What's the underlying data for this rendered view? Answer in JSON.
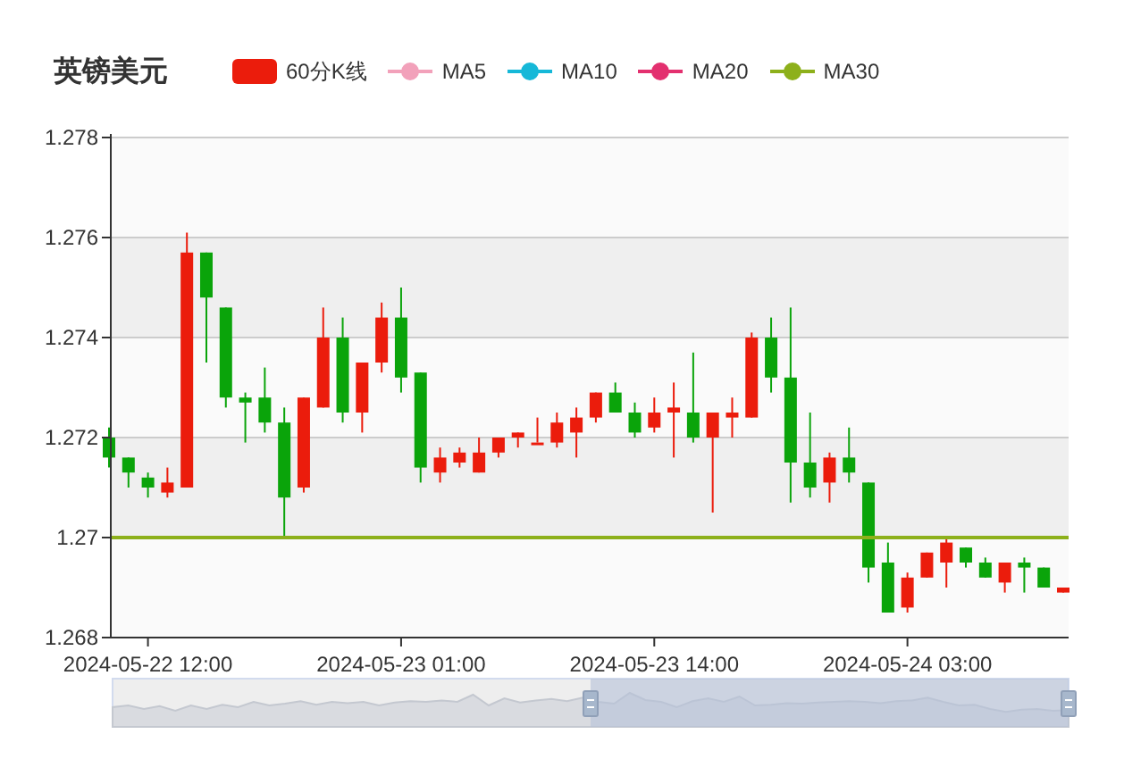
{
  "title": "英镑美元",
  "legend": {
    "label": "60分K线",
    "color": "#eb1c0c"
  },
  "chart_data": {
    "type": "candlestick",
    "ylim": [
      1.268,
      1.278
    ],
    "yticks": [
      {
        "value": 1.278,
        "label": "1.278"
      },
      {
        "value": 1.276,
        "label": "1.276"
      },
      {
        "value": 1.274,
        "label": "1.274"
      },
      {
        "value": 1.272,
        "label": "1.272"
      },
      {
        "value": 1.27,
        "label": "1.27"
      },
      {
        "value": 1.268,
        "label": "1.268"
      }
    ],
    "categories": [
      null,
      null,
      "2024-05-22 12:00",
      null,
      null,
      null,
      null,
      null,
      null,
      null,
      null,
      null,
      null,
      null,
      null,
      "2024-05-23 01:00",
      null,
      null,
      null,
      null,
      null,
      null,
      null,
      null,
      null,
      null,
      null,
      null,
      "2024-05-23 14:00",
      null,
      null,
      null,
      null,
      null,
      null,
      null,
      null,
      null,
      null,
      null,
      null,
      "2024-05-24 03:00",
      null,
      null,
      null,
      null,
      null,
      null,
      null,
      null
    ],
    "ohlc": [
      [
        1.272,
        1.2722,
        1.2714,
        1.2716
      ],
      [
        1.2716,
        1.2716,
        1.271,
        1.2713
      ],
      [
        1.2712,
        1.2713,
        1.2708,
        1.271
      ],
      [
        1.2709,
        1.2714,
        1.2708,
        1.2711
      ],
      [
        1.271,
        1.2761,
        1.271,
        1.2757
      ],
      [
        1.2757,
        1.2757,
        1.2735,
        1.2748
      ],
      [
        1.2746,
        1.2746,
        1.2726,
        1.2728
      ],
      [
        1.2728,
        1.2729,
        1.2719,
        1.2727
      ],
      [
        1.2728,
        1.2734,
        1.2721,
        1.2723
      ],
      [
        1.2723,
        1.2726,
        1.27,
        1.2708
      ],
      [
        1.271,
        1.2728,
        1.2709,
        1.2728
      ],
      [
        1.2726,
        1.2746,
        1.2726,
        1.274
      ],
      [
        1.274,
        1.2744,
        1.2723,
        1.2725
      ],
      [
        1.2725,
        1.2735,
        1.2721,
        1.2735
      ],
      [
        1.2735,
        1.2747,
        1.2733,
        1.2744
      ],
      [
        1.2744,
        1.275,
        1.2729,
        1.2732
      ],
      [
        1.2733,
        1.2733,
        1.2711,
        1.2714
      ],
      [
        1.2713,
        1.2718,
        1.2711,
        1.2716
      ],
      [
        1.2715,
        1.2718,
        1.2714,
        1.2717
      ],
      [
        1.2713,
        1.272,
        1.2713,
        1.2717
      ],
      [
        1.2717,
        1.272,
        1.2716,
        1.272
      ],
      [
        1.272,
        1.2721,
        1.2718,
        1.2721
      ],
      [
        1.2719,
        1.2724,
        1.2719,
        1.2719
      ],
      [
        1.2719,
        1.2725,
        1.2718,
        1.2723
      ],
      [
        1.2721,
        1.2726,
        1.2716,
        1.2724
      ],
      [
        1.2724,
        1.2729,
        1.2723,
        1.2729
      ],
      [
        1.2729,
        1.2731,
        1.2725,
        1.2725
      ],
      [
        1.2725,
        1.2727,
        1.272,
        1.2721
      ],
      [
        1.2722,
        1.2728,
        1.2721,
        1.2725
      ],
      [
        1.2725,
        1.2731,
        1.2716,
        1.2726
      ],
      [
        1.2725,
        1.2737,
        1.2719,
        1.272
      ],
      [
        1.272,
        1.2725,
        1.2705,
        1.2725
      ],
      [
        1.2724,
        1.2728,
        1.272,
        1.2725
      ],
      [
        1.2724,
        1.2741,
        1.2724,
        1.274
      ],
      [
        1.274,
        1.2744,
        1.2729,
        1.2732
      ],
      [
        1.2732,
        1.2746,
        1.2707,
        1.2715
      ],
      [
        1.2715,
        1.2725,
        1.2708,
        1.271
      ],
      [
        1.2711,
        1.2717,
        1.2707,
        1.2716
      ],
      [
        1.2716,
        1.2722,
        1.2711,
        1.2713
      ],
      [
        1.2711,
        1.2711,
        1.2691,
        1.2694
      ],
      [
        1.2695,
        1.2699,
        1.2685,
        1.2685
      ],
      [
        1.2686,
        1.2693,
        1.2685,
        1.2692
      ],
      [
        1.2692,
        1.2697,
        1.2692,
        1.2697
      ],
      [
        1.2695,
        1.27,
        1.269,
        1.2699
      ],
      [
        1.2698,
        1.2698,
        1.2694,
        1.2695
      ],
      [
        1.2695,
        1.2696,
        1.2692,
        1.2692
      ],
      [
        1.2691,
        1.2695,
        1.2689,
        1.2695
      ],
      [
        1.2695,
        1.2696,
        1.2689,
        1.2694
      ],
      [
        1.2694,
        1.2694,
        1.269,
        1.269
      ],
      [
        1.2689,
        1.269,
        1.2689,
        1.269
      ]
    ],
    "series": [
      {
        "name": "MA5",
        "color": "#f2a1ba",
        "values": [
          null,
          null,
          null,
          null,
          null,
          null,
          null,
          null,
          null,
          null,
          null,
          null,
          null,
          null,
          null,
          null,
          null,
          null,
          null,
          null,
          null,
          null,
          null,
          null,
          null,
          null,
          null,
          null,
          null,
          null,
          null,
          null,
          null,
          null,
          null,
          null,
          null,
          null,
          null,
          null,
          null,
          null,
          null,
          null,
          null,
          null,
          null,
          null,
          null,
          null
        ]
      },
      {
        "name": "MA10",
        "color": "#16b8d8",
        "values": [
          null,
          null,
          null,
          null,
          null,
          null,
          null,
          null,
          null,
          null,
          null,
          null,
          null,
          null,
          null,
          null,
          null,
          null,
          null,
          null,
          null,
          null,
          null,
          null,
          null,
          null,
          null,
          null,
          null,
          null,
          null,
          null,
          null,
          null,
          null,
          null,
          null,
          null,
          null,
          null,
          null,
          null,
          null,
          null,
          null,
          null,
          null,
          null,
          null,
          null
        ]
      },
      {
        "name": "MA20",
        "color": "#e3306f",
        "values": [
          null,
          null,
          null,
          null,
          null,
          null,
          null,
          null,
          null,
          null,
          null,
          null,
          null,
          null,
          null,
          null,
          null,
          null,
          null,
          null,
          null,
          null,
          null,
          null,
          null,
          null,
          null,
          null,
          null,
          null,
          null,
          null,
          null,
          null,
          null,
          null,
          null,
          null,
          null,
          null,
          null,
          null,
          null,
          null,
          null,
          null,
          null,
          null,
          null,
          null
        ]
      },
      {
        "name": "MA30",
        "color": "#8db01b",
        "values": [
          null,
          null,
          null,
          null,
          null,
          null,
          null,
          null,
          null,
          null,
          null,
          null,
          null,
          null,
          null,
          null,
          null,
          null,
          null,
          null,
          null,
          null,
          null,
          null,
          null,
          null,
          null,
          null,
          null,
          null,
          null,
          null,
          null,
          null,
          null,
          null,
          null,
          null,
          null,
          null,
          null,
          null,
          null,
          null,
          null,
          null,
          null,
          null,
          null,
          null
        ]
      }
    ],
    "ref_lines": [
      {
        "axis": "y",
        "value": 1.27,
        "color": "#8db01b"
      }
    ],
    "grid": true
  },
  "zoom_slider": {
    "level": 0.5
  }
}
